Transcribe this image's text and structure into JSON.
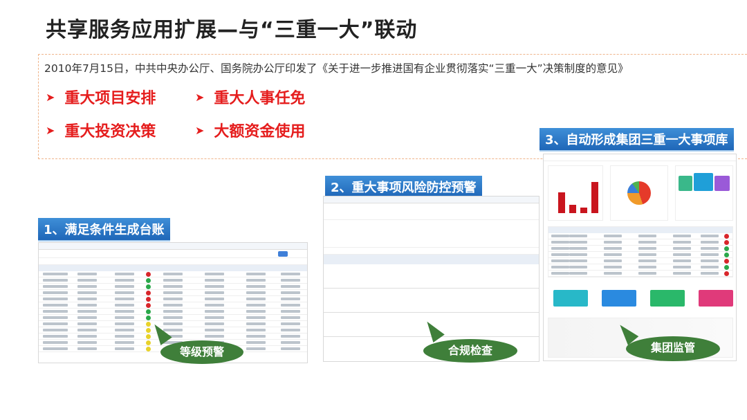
{
  "title": "共享服务应用扩展—与“三重一大”联动",
  "intro": "2010年7月15日，中共中央办公厅、国务院办公厅印发了《关于进一步推进国有企业贯彻落实“三重一大”决策制度的意见》",
  "bullets": [
    "重大项目安排",
    "重大人事任免",
    "重大投资决策",
    "大额资金使用"
  ],
  "sections": [
    {
      "label": "1、满足条件生成台账",
      "bubble": "等级预警"
    },
    {
      "label": "2、重大事项风险防控预警",
      "bubble": "合规检查"
    },
    {
      "label": "3、自动形成集团三重一大事项库",
      "bubble": "集团监管"
    }
  ],
  "colors": {
    "accent_red": "#e51d1d",
    "label_blue": "#1f66b8",
    "bubble_green": "#3f7f3a"
  },
  "icons": {
    "bullet": "arrow-right-icon"
  }
}
